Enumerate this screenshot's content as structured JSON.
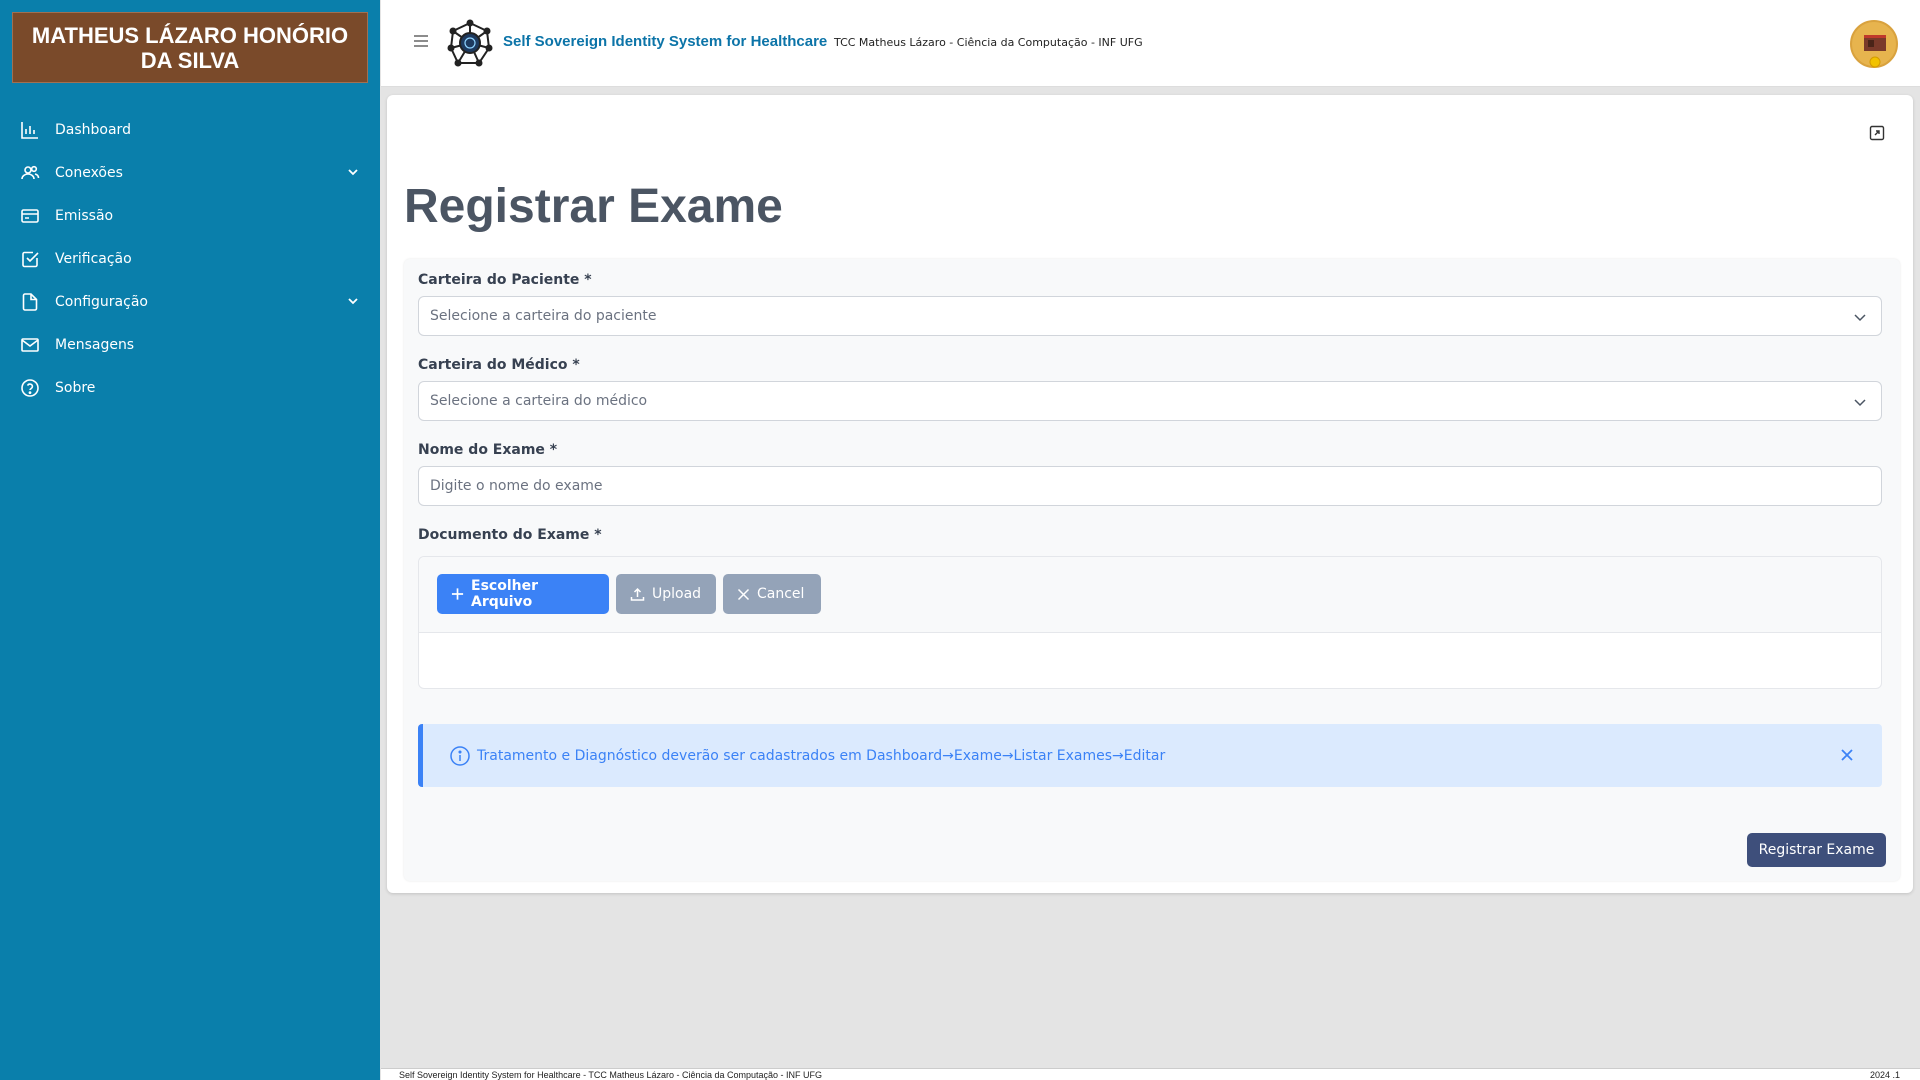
{
  "sidebar": {
    "title": "MATHEUS LÁZARO HONÓRIO DA SILVA",
    "items": [
      {
        "label": "Dashboard",
        "icon": "bar-chart-icon"
      },
      {
        "label": "Conexões",
        "icon": "users-icon"
      },
      {
        "label": "Emissão",
        "icon": "credit-card-icon"
      },
      {
        "label": "Verificação",
        "icon": "check-square-icon"
      },
      {
        "label": "Configuração",
        "icon": "file-icon"
      },
      {
        "label": "Mensagens",
        "icon": "envelope-icon"
      },
      {
        "label": "Sobre",
        "icon": "help-circle-icon"
      }
    ]
  },
  "header": {
    "app_title": "Self Sovereign Identity System for Healthcare",
    "subtitle": "TCC Matheus Lázaro - Ciência da Computação - INF UFG"
  },
  "page": {
    "title": "Registrar Exame"
  },
  "form": {
    "patient_label": "Carteira do Paciente *",
    "patient_placeholder": "Selecione a carteira do paciente",
    "doctor_label": "Carteira do Médico *",
    "doctor_placeholder": "Selecione a carteira do médico",
    "exam_name_label": "Nome do Exame *",
    "exam_name_placeholder": "Digite o nome do exame",
    "document_label": "Documento do Exame *",
    "choose_label": "Escolher Arquivo",
    "upload_label": "Upload",
    "cancel_label": "Cancel",
    "info_message": "Tratamento e Diagnóstico deverão ser cadastrados em Dashboard→Exame→Listar Exames→Editar",
    "submit_label": "Registrar Exame"
  },
  "footer": {
    "left": "Self Sovereign Identity System for Healthcare - TCC Matheus Lázaro - Ciência da Computação - INF UFG",
    "right": "2024 .1"
  },
  "colors": {
    "sidebar": "#0a7fab",
    "title_box": "#7a4a2a",
    "primary": "#3b82f6",
    "submit": "#3e4f7b"
  }
}
